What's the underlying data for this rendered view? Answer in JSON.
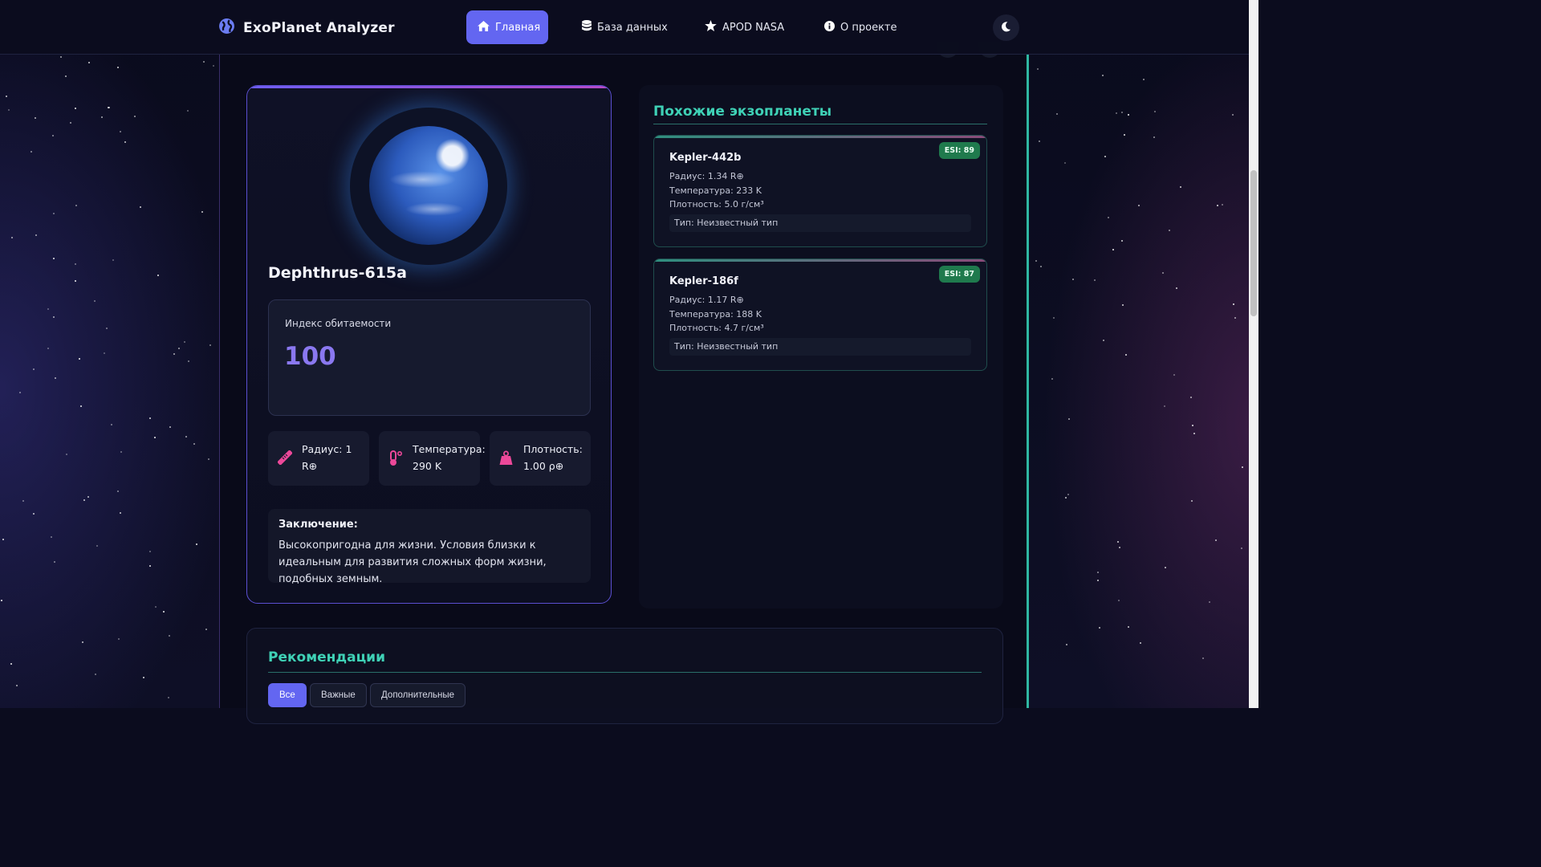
{
  "app": {
    "brand": "ExoPlanet Analyzer",
    "nav": [
      {
        "label": "Главная",
        "active": true,
        "icon": "home-icon"
      },
      {
        "label": "База данных",
        "active": false,
        "icon": "database-icon"
      },
      {
        "label": "APOD NASA",
        "active": false,
        "icon": "star-icon"
      },
      {
        "label": "О проекте",
        "active": false,
        "icon": "info-icon"
      }
    ],
    "theme_toggle_icon": "moon-icon"
  },
  "planet": {
    "name": "Dephthrus-615a",
    "habitability_label": "Индекс обитаемости",
    "habitability_value": "100",
    "stats": [
      {
        "label": "Радиус:",
        "value": "1 R⊕",
        "icon": "ruler-icon"
      },
      {
        "label": "Температура:",
        "value": "290 K",
        "icon": "thermometer-icon"
      },
      {
        "label": "Плотность:",
        "value": "1.00 ρ⊕",
        "icon": "weight-icon"
      }
    ],
    "conclusion_title": "Заключение:",
    "conclusion_text": "Высокопригодна для жизни. Условия близки к идеальным для развития сложных форм жизни, подобных земным."
  },
  "similar": {
    "title": "Похожие экзопланеты",
    "items": [
      {
        "name": "Kepler-442b",
        "esi": "ESI: 89",
        "radius": "Радиус: 1.34 R⊕",
        "temperature": "Температура: 233 K",
        "density": "Плотность: 5.0 г/см³",
        "type": "Тип: Неизвестный тип"
      },
      {
        "name": "Kepler-186f",
        "esi": "ESI: 87",
        "radius": "Радиус: 1.17 R⊕",
        "temperature": "Температура: 188 K",
        "density": "Плотность: 4.7 г/см³",
        "type": "Тип: Неизвестный тип"
      }
    ]
  },
  "recommendations": {
    "title": "Рекомендации",
    "filters": [
      {
        "label": "Все",
        "active": true
      },
      {
        "label": "Важные",
        "active": false
      },
      {
        "label": "Дополнительные",
        "active": false
      }
    ]
  },
  "colors": {
    "accent": "#6366f1",
    "teal": "#3fd1b6",
    "badge_green": "#1f7a4d",
    "icon_pink": "#ec4899"
  }
}
